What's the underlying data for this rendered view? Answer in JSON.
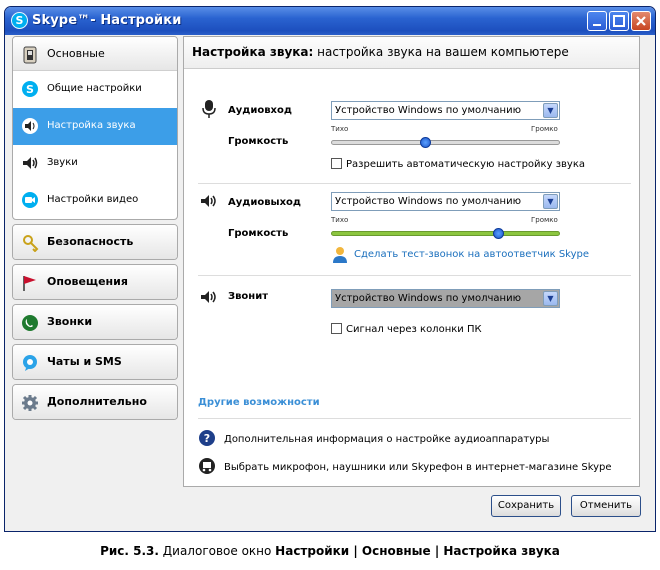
{
  "window": {
    "title": "Skype™- Настройки",
    "logo_letter": "S",
    "controls": [
      "minimize",
      "maximize",
      "close"
    ]
  },
  "sidebar": {
    "groups": [
      {
        "label": "Основные",
        "icon": "switch-icon",
        "items": [
          {
            "label": "Общие настройки",
            "icon": "skype-icon"
          },
          {
            "label": "Настройка звука",
            "icon": "speaker-icon",
            "active": true
          },
          {
            "label": "Звуки",
            "icon": "speaker-icon"
          },
          {
            "label": "Настройки видео",
            "icon": "video-icon"
          }
        ]
      },
      {
        "label": "Безопасность",
        "icon": "lock-icon"
      },
      {
        "label": "Оповещения",
        "icon": "flag-icon"
      },
      {
        "label": "Звонки",
        "icon": "phone-icon"
      },
      {
        "label": "Чаты и SMS",
        "icon": "chat-icon"
      },
      {
        "label": "Дополнительно",
        "icon": "gear-icon"
      }
    ]
  },
  "content": {
    "header_bold": "Настройка звука:",
    "header_rest": " настройка звука на вашем компьютере",
    "audio_in": {
      "label": "Аудиовход",
      "device": "Устройство Windows по умолчанию",
      "volume_label": "Громкость",
      "slider_min": "Тихо",
      "slider_max": "Громко",
      "level": 0.41,
      "checkbox_label": "Разрешить автоматическую настройку звука",
      "checked": false
    },
    "audio_out": {
      "label": "Аудиовыход",
      "device": "Устройство Windows по умолчанию",
      "volume_label": "Громкость",
      "slider_min": "Тихо",
      "slider_max": "Громко",
      "level": 0.73,
      "test_call": "Сделать тест-звонок на автоответчик Skype"
    },
    "ringing": {
      "label": "Звонит",
      "device": "Устройство Windows по умолчанию",
      "checkbox_label": "Сигнал через колонки ПК",
      "checked": false
    },
    "other_title": "Другие возможности",
    "info_link": "Дополнительная информация о настройке аудиоаппаратуры",
    "shop_link": "Выбрать микрофон, наушники или Skypeфон в интернет-магазине Skype"
  },
  "buttons": {
    "save": "Сохранить",
    "cancel": "Отменить"
  },
  "caption": {
    "prefix": "Рис. 5.3.",
    "text": " Диалоговое окно ",
    "path": "Настройки | Основные | Настройка звука"
  },
  "colors": {
    "titlebar": "#2a63d0",
    "active_item": "#3c9ee8",
    "link": "#3b8fd6",
    "green_slider": "#8cc63f"
  }
}
